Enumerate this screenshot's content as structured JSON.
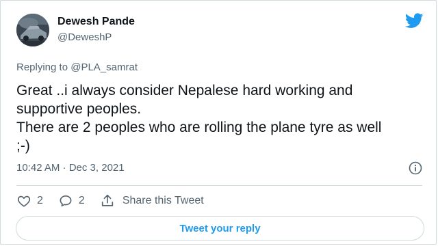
{
  "author": {
    "name": "Dewesh Pande",
    "handle": "@DeweshP"
  },
  "reply_context": {
    "prefix": "Replying to ",
    "mention": "@PLA_samrat"
  },
  "tweet": {
    "lines": [
      "Great ..i always consider Nepalese hard working and",
      "supportive peoples.",
      "There are 2 peoples who are rolling the plane tyre as well",
      ";-)"
    ],
    "timestamp": "10:42 AM · Dec 3, 2021"
  },
  "actions": {
    "like_count": "2",
    "reply_count": "2",
    "share_label": "Share this Tweet"
  },
  "reply_button_label": "Tweet your reply",
  "icons": {
    "brand": "twitter-bird-icon",
    "info": "info-icon",
    "like": "heart-icon",
    "reply": "reply-bubble-icon",
    "share": "share-icon"
  },
  "colors": {
    "brand_blue": "#1d9bf0",
    "text_primary": "#0f1419",
    "text_secondary": "#536471",
    "border": "#cfd9de"
  }
}
